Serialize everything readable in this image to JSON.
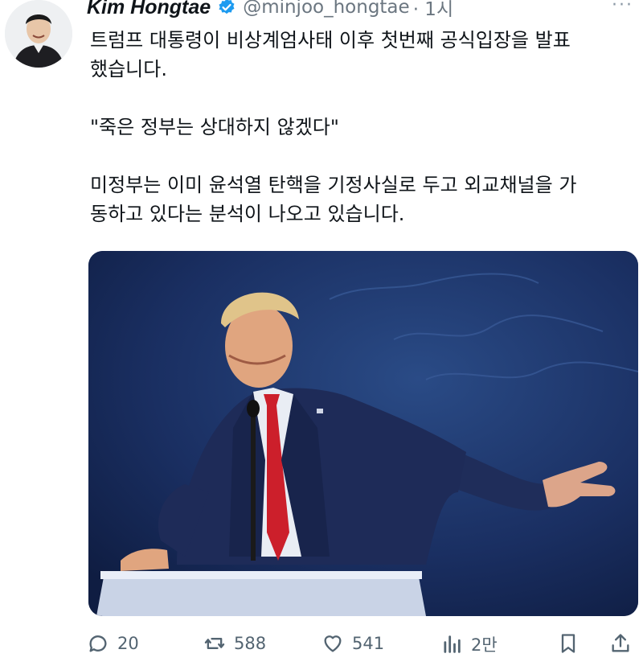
{
  "user": {
    "name": "Kim Hongtae",
    "handle": "@minjoo_hongtae",
    "time": "· 1시"
  },
  "more_label": "···",
  "paragraphs": [
    "트럼프 대통령이 비상계엄사태 이후 첫번째 공식입장을 발표",
    "했습니다.",
    "\"죽은 정부는 상대하지 않겠다\"",
    "미정부는 이미 윤석열 탄핵을 기정사실로 두고 외교채널을 가",
    "동하고 있다는 분석이 나오고 있습니다."
  ],
  "stats": {
    "replies": "20",
    "reposts": "588",
    "likes": "541",
    "views": "2만"
  },
  "icons": [
    "reply-icon",
    "repost-icon",
    "like-icon",
    "views-icon",
    "bookmark-icon",
    "share-icon",
    "verified-badge-icon"
  ],
  "colors": {
    "verified": "#1d9bf0",
    "muted": "#536471"
  }
}
